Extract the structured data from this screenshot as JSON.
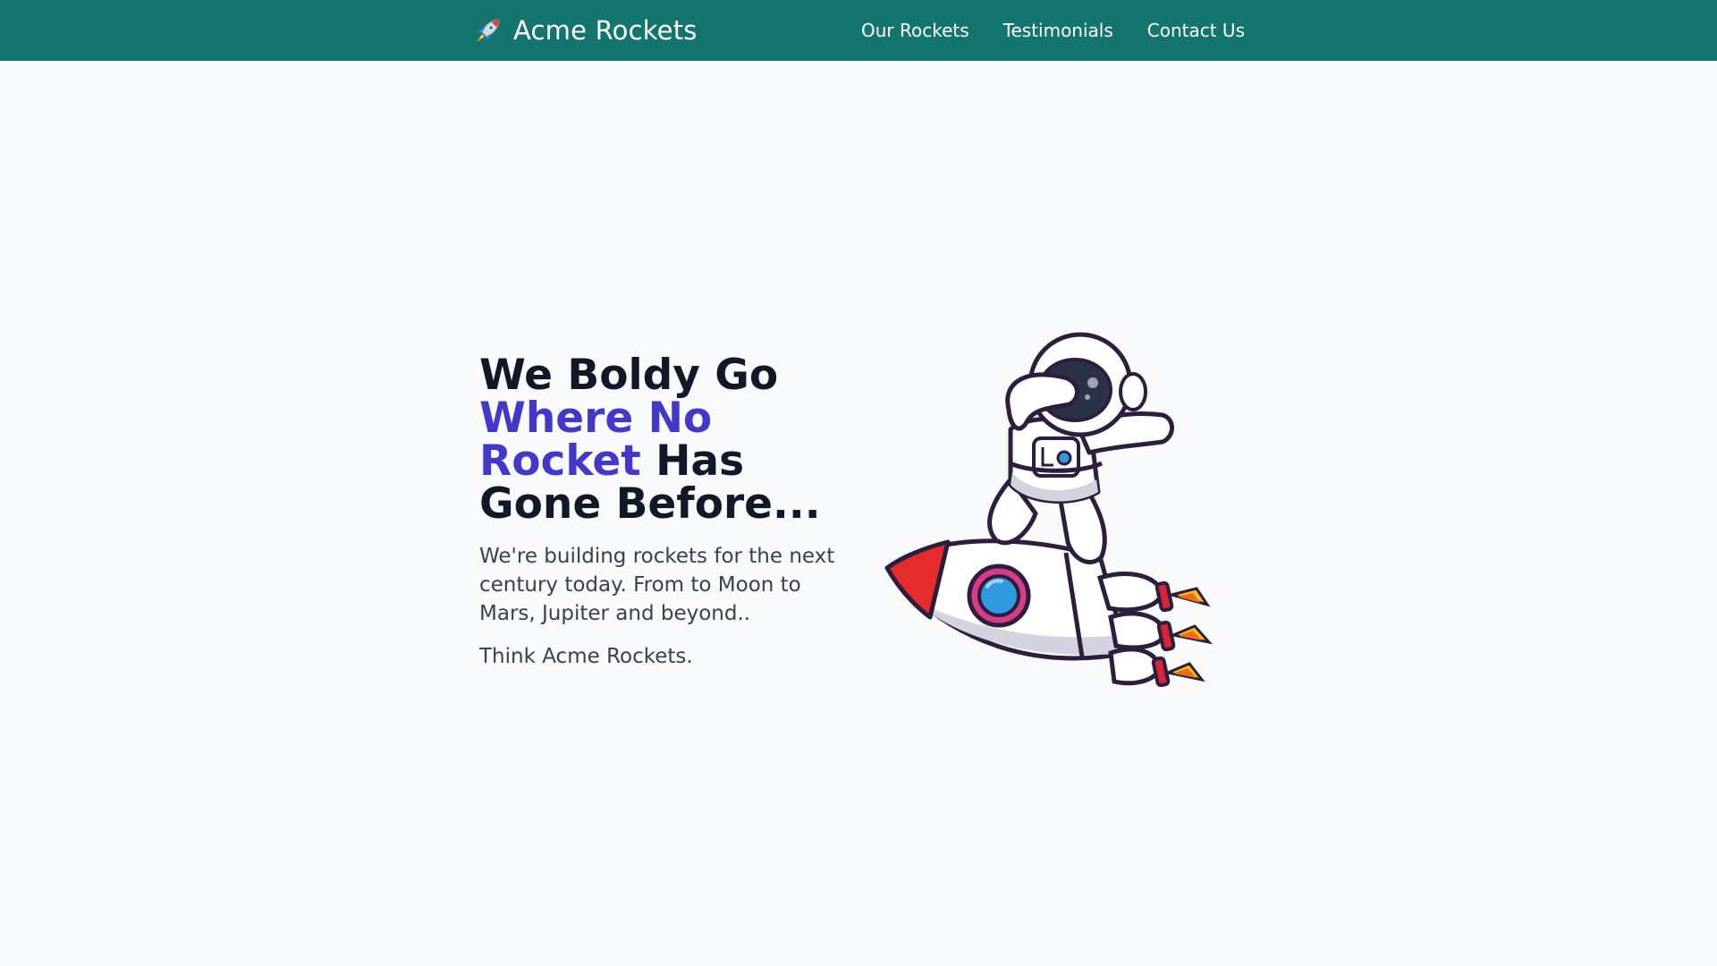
{
  "header": {
    "brand_icon": "rocket-icon",
    "brand_name": "Acme Rockets",
    "nav": [
      {
        "label": "Our Rockets"
      },
      {
        "label": "Testimonials"
      },
      {
        "label": "Contact Us"
      }
    ]
  },
  "hero": {
    "headline_part1": "We Boldy Go",
    "headline_accent": "Where No Rocket",
    "headline_part2": "Has Gone Before...",
    "description": "We're building rockets for the next century today. From to Moon to Mars, Jupiter and beyond..",
    "tagline": "Think Acme Rockets.",
    "illustration": "astronaut-riding-rocket"
  },
  "colors": {
    "header_bg": "#13756e",
    "accent": "#4338ca",
    "heading": "#111827",
    "body_text": "#374151",
    "page_bg": "#f8fafc"
  }
}
